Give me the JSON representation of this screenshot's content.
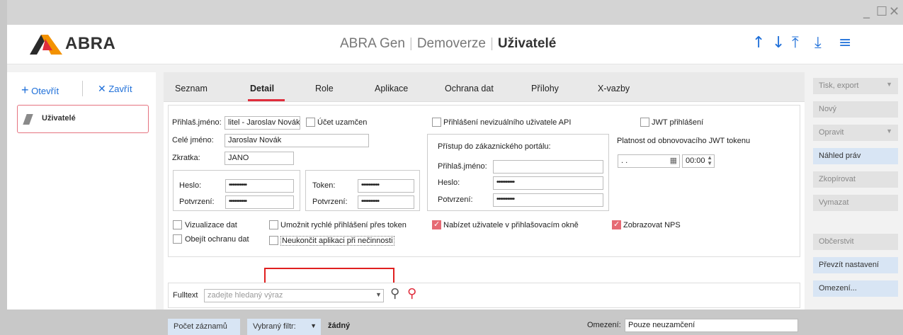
{
  "window": {
    "controls": [
      "_",
      "☐",
      "✕"
    ]
  },
  "header": {
    "logo_text": "ABRA",
    "app_name": "ABRA Gen",
    "separator": "|",
    "company": "Demoverze",
    "current": "Uživatelé",
    "nav_icons": [
      "↑",
      "↓",
      "⤒",
      "⤓",
      "≡"
    ]
  },
  "left": {
    "open_label": "Otevřít",
    "open_icon": "+",
    "close_label": "Zavřít",
    "close_icon": "✕",
    "item_label": "Uživatelé"
  },
  "tabs": [
    "Seznam",
    "Detail",
    "Role",
    "Aplikace",
    "Ochrana dat",
    "Přílohy",
    "X-vazby"
  ],
  "form": {
    "login_label": "Přihlaš.jméno:",
    "login_value": "litel - Jaroslav Novák",
    "fullname_label": "Celé jméno:",
    "fullname_value": "Jaroslav Novák",
    "abbr_label": "Zkratka:",
    "abbr_value": "JANO",
    "account_locked": "Účet uzamčen",
    "password_label": "Heslo:",
    "password_value": "••••••••••",
    "confirm_label": "Potvrzení:",
    "confirm_value": "••••••••••",
    "token_label": "Token:",
    "token_value": "••••••••••",
    "token_confirm_label": "Potvrzení:",
    "token_confirm_value": "••••••••••",
    "api_login": "Přihlášení nevizuálního uživatele API",
    "jwt_login": "JWT přihlášení",
    "portal_title": "Přístup do zákaznického portálu:",
    "portal_login_label": "Přihlaš.jméno:",
    "portal_password_label": "Heslo:",
    "portal_password_value": "••••••••••",
    "portal_confirm_label": "Potvrzení:",
    "portal_confirm_value": "••••••••••",
    "jwt_validity_label": "Platnost od obnovovacího JWT tokenu",
    "jwt_date": ". .",
    "jwt_time": "00:00",
    "visualization": "Vizualizace dat",
    "fast_login": "Umožnit rychlé přihlášení přes token",
    "offer_user": "Nabízet uživatele v přihlašovacím okně",
    "show_nps": "Zobrazovat NPS",
    "bypass": "Obejít ochranu dat",
    "no_quit": "Neukončit aplikaci při nečinnosti"
  },
  "fulltext": {
    "label": "Fulltext",
    "placeholder": "zadejte hledaný výraz"
  },
  "bottom": {
    "count_label": "Počet záznamů",
    "filter_label": "Vybraný filtr:",
    "filter_value": "žádný",
    "limit_label": "Omezení:",
    "limit_value": "Pouze neuzamčení"
  },
  "right": {
    "print": "Tisk, export",
    "new": "Nový",
    "edit": "Opravit",
    "preview": "Náhled práv",
    "copy": "Zkopírovat",
    "delete": "Vymazat",
    "refresh": "Občerstvit",
    "take_settings": "Převzít nastavení",
    "limits": "Omezení..."
  },
  "colors": {
    "accent": "#1e6fd9",
    "brand_red": "#e02d3c",
    "logo_orange": "#f39200"
  }
}
